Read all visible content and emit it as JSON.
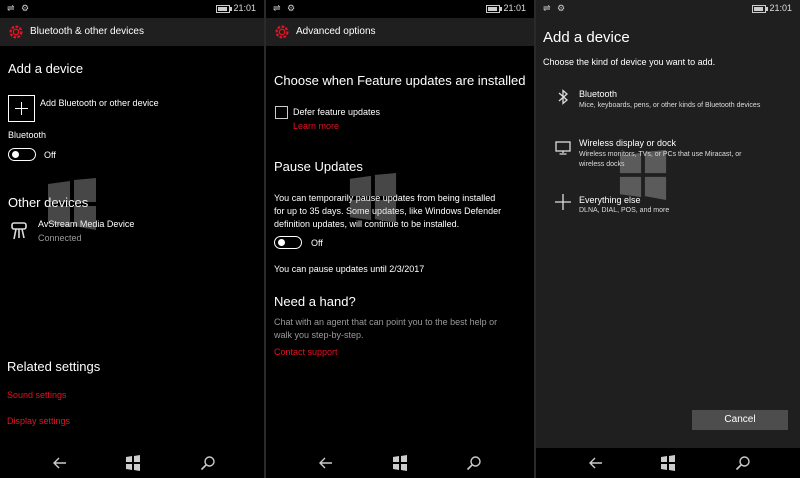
{
  "status_bar": {
    "time": "21:01"
  },
  "panel1": {
    "header_title": "Bluetooth & other devices",
    "add_device_heading": "Add a device",
    "add_button_label": "Add Bluetooth or other device",
    "bluetooth_label": "Bluetooth",
    "bluetooth_state": "Off",
    "other_devices_heading": "Other devices",
    "device_name": "AvStream Media Device",
    "device_status": "Connected",
    "related_heading": "Related settings",
    "sound_settings": "Sound settings",
    "display_settings": "Display settings"
  },
  "panel2": {
    "header_title": "Advanced options",
    "feature_heading": "Choose when Feature updates are installed",
    "defer_label": "Defer feature updates",
    "learn_more": "Learn more",
    "pause_heading": "Pause Updates",
    "pause_desc_1": "You can temporarily pause updates from being installed",
    "pause_desc_2": "for up to 35 days. Some updates, like Windows Defender",
    "pause_desc_3": "definition updates, will continue to be installed.",
    "pause_state": "Off",
    "pause_until": "You can pause updates until 2/3/2017",
    "help_heading": "Need a hand?",
    "help_desc_1": "Chat with an agent that can point you to the best help or",
    "help_desc_2": "walk you step-by-step.",
    "contact_support": "Contact support"
  },
  "panel3": {
    "title": "Add a device",
    "subtitle": "Choose the kind of device you want to add.",
    "options": [
      {
        "title": "Bluetooth",
        "desc": "Mice, keyboards, pens, or other kinds of Bluetooth devices",
        "icon": "bluetooth-icon"
      },
      {
        "title": "Wireless display or dock",
        "desc": "Wireless monitors, TVs, or PCs that use Miracast, or",
        "desc2": "wireless docks",
        "icon": "monitor-icon"
      },
      {
        "title": "Everything else",
        "desc": "DLNA, DIAL, POS, and more",
        "icon": "plus-icon"
      }
    ],
    "cancel_label": "Cancel"
  },
  "colors": {
    "accent_red": "#e81123",
    "header_bg": "#1f1f1f",
    "panel3_bg": "#1f1f1f",
    "button_bg": "#4d4d4d"
  },
  "navbar": {
    "icons": [
      "back-icon",
      "windows-icon",
      "search-icon"
    ]
  }
}
